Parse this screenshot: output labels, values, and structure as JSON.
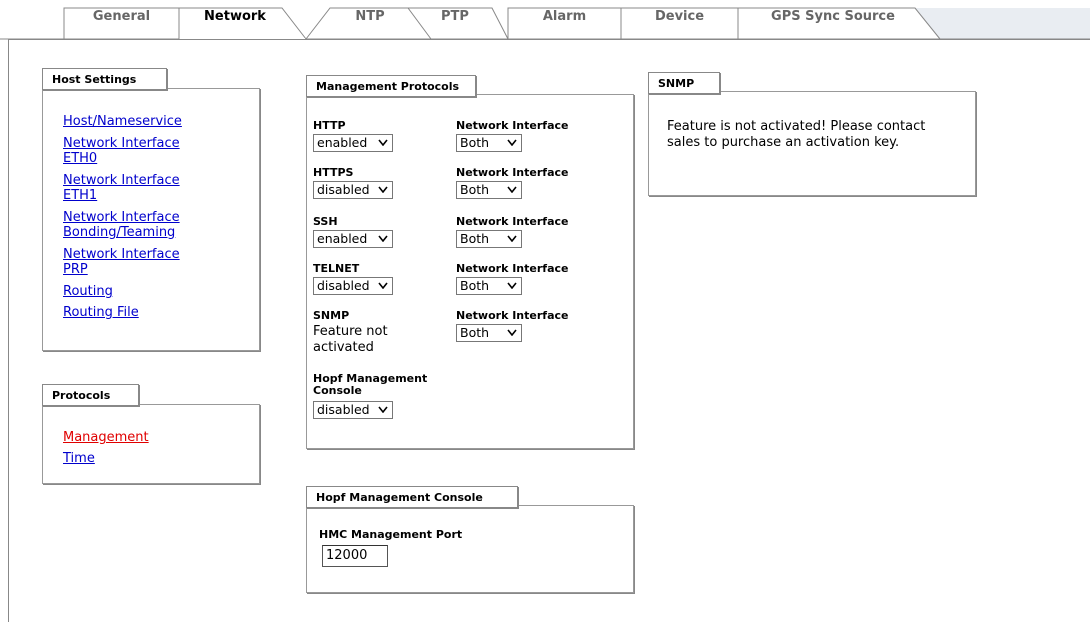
{
  "tabs": [
    {
      "label": "General",
      "active": false
    },
    {
      "label": "Network",
      "active": true
    },
    {
      "label": "NTP",
      "active": false
    },
    {
      "label": "PTP",
      "active": false
    },
    {
      "label": "Alarm",
      "active": false
    },
    {
      "label": "Device",
      "active": false
    },
    {
      "label": "GPS Sync Source",
      "active": false
    }
  ],
  "host_settings": {
    "title": "Host Settings",
    "links": [
      {
        "label": "Host/Nameservice"
      },
      {
        "label": "Network Interface ETH0"
      },
      {
        "label": "Network Interface ETH1"
      },
      {
        "label": "Network Interface Bonding/Teaming"
      },
      {
        "label": "Network Interface PRP"
      },
      {
        "label": "Routing"
      },
      {
        "label": "Routing File"
      }
    ]
  },
  "protocols": {
    "title": "Protocols",
    "links": [
      {
        "label": "Management",
        "active": true
      },
      {
        "label": "Time",
        "active": false
      }
    ]
  },
  "management_protocols": {
    "title": "Management Protocols",
    "rows": [
      {
        "name": "HTTP",
        "value": "enabled",
        "iface_label": "Network Interface",
        "iface_value": "Both"
      },
      {
        "name": "HTTPS",
        "value": "disabled",
        "iface_label": "Network Interface",
        "iface_value": "Both"
      },
      {
        "name": "SSH",
        "value": "enabled",
        "iface_label": "Network Interface",
        "iface_value": "Both"
      },
      {
        "name": "TELNET",
        "value": "disabled",
        "iface_label": "Network Interface",
        "iface_value": "Both"
      },
      {
        "name": "SNMP",
        "status_text": "Feature not activated",
        "iface_label": "Network Interface",
        "iface_value": "Both"
      }
    ],
    "hmc": {
      "name": "Hopf Management Console",
      "value": "disabled"
    }
  },
  "snmp": {
    "title": "SNMP",
    "message": "Feature is not activated! Please contact sales to purchase an activation key."
  },
  "hmc_panel": {
    "title": "Hopf Management Console",
    "port_label": "HMC Management Port",
    "port_value": "12000"
  },
  "colors": {
    "link": "#0000cc",
    "active_link": "#e00000",
    "border": "#888888"
  }
}
